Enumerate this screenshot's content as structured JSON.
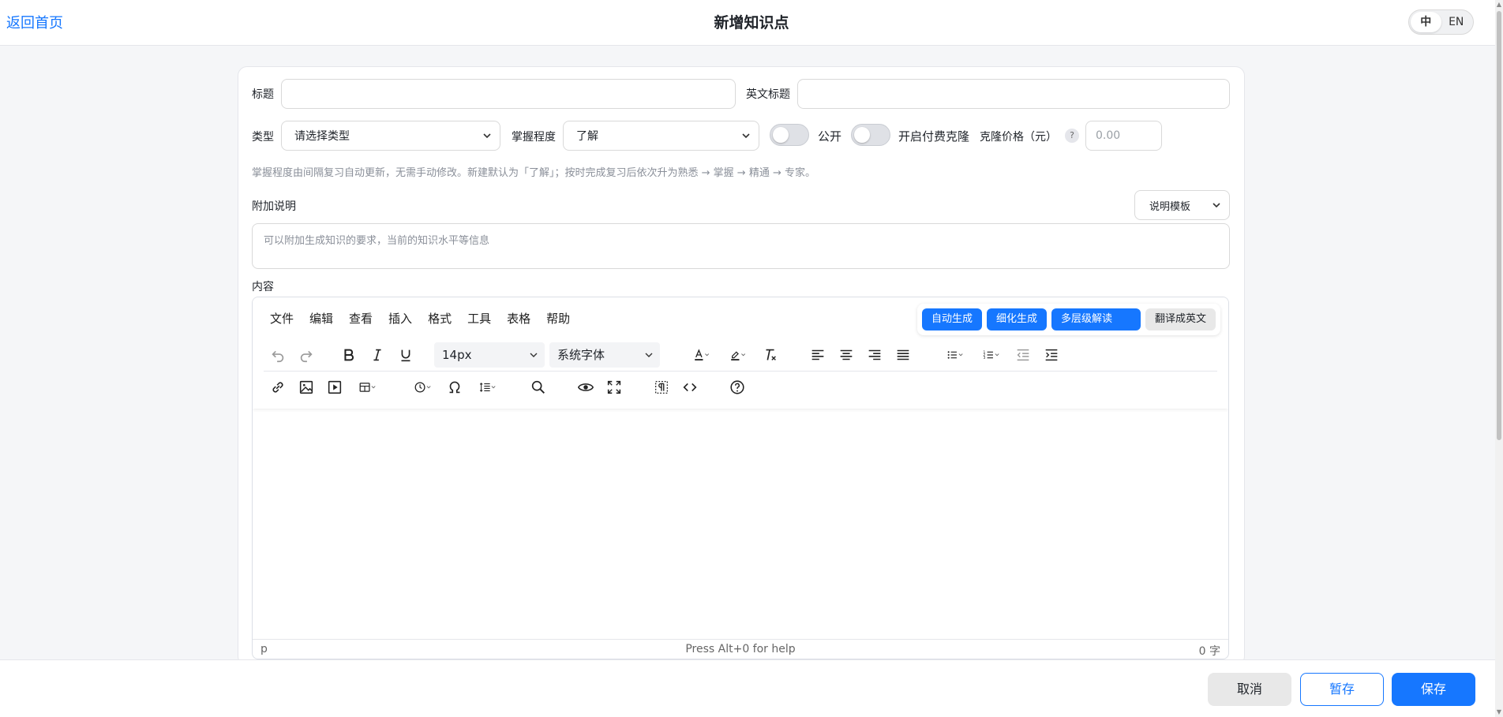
{
  "header": {
    "back_label": "返回首页",
    "title": "新增知识点",
    "lang_zh": "中",
    "lang_en": "EN"
  },
  "form": {
    "title_label": "标题",
    "title_value": "",
    "en_title_label": "英文标题",
    "en_title_value": "",
    "type_label": "类型",
    "type_value": "请选择类型",
    "mastery_label": "掌握程度",
    "mastery_value": "了解",
    "public_label": "公开",
    "paid_clone_label": "开启付费克隆",
    "clone_price_label": "克隆价格（元）",
    "clone_price_help": "?",
    "clone_price_placeholder": "0.00",
    "hint": "掌握程度由间隔复习自动更新，无需手动修改。新建默认为「了解」；按时完成复习后依次升为熟悉 → 掌握 → 精通 → 专家。",
    "extra_label": "附加说明",
    "template_select": "说明模板",
    "extra_placeholder": "可以附加生成知识的要求，当前的知识水平等信息",
    "content_label": "内容"
  },
  "editor": {
    "menus": [
      "文件",
      "编辑",
      "查看",
      "插入",
      "格式",
      "工具",
      "表格",
      "帮助"
    ],
    "ai_buttons": {
      "auto": "自动生成",
      "refine": "细化生成",
      "multilevel": "多层级解读",
      "translate": "翻译成英文"
    },
    "font_size": "14px",
    "font_family": "系统字体",
    "status_path": "p",
    "status_help": "Press Alt+0 for help",
    "status_count": "0 字"
  },
  "footer": {
    "cancel": "取消",
    "draft": "暂存",
    "save": "保存"
  },
  "colors": {
    "primary": "#1677ff",
    "text": "#1f2329",
    "muted": "#8a8f99",
    "border": "#d9d9d9"
  }
}
